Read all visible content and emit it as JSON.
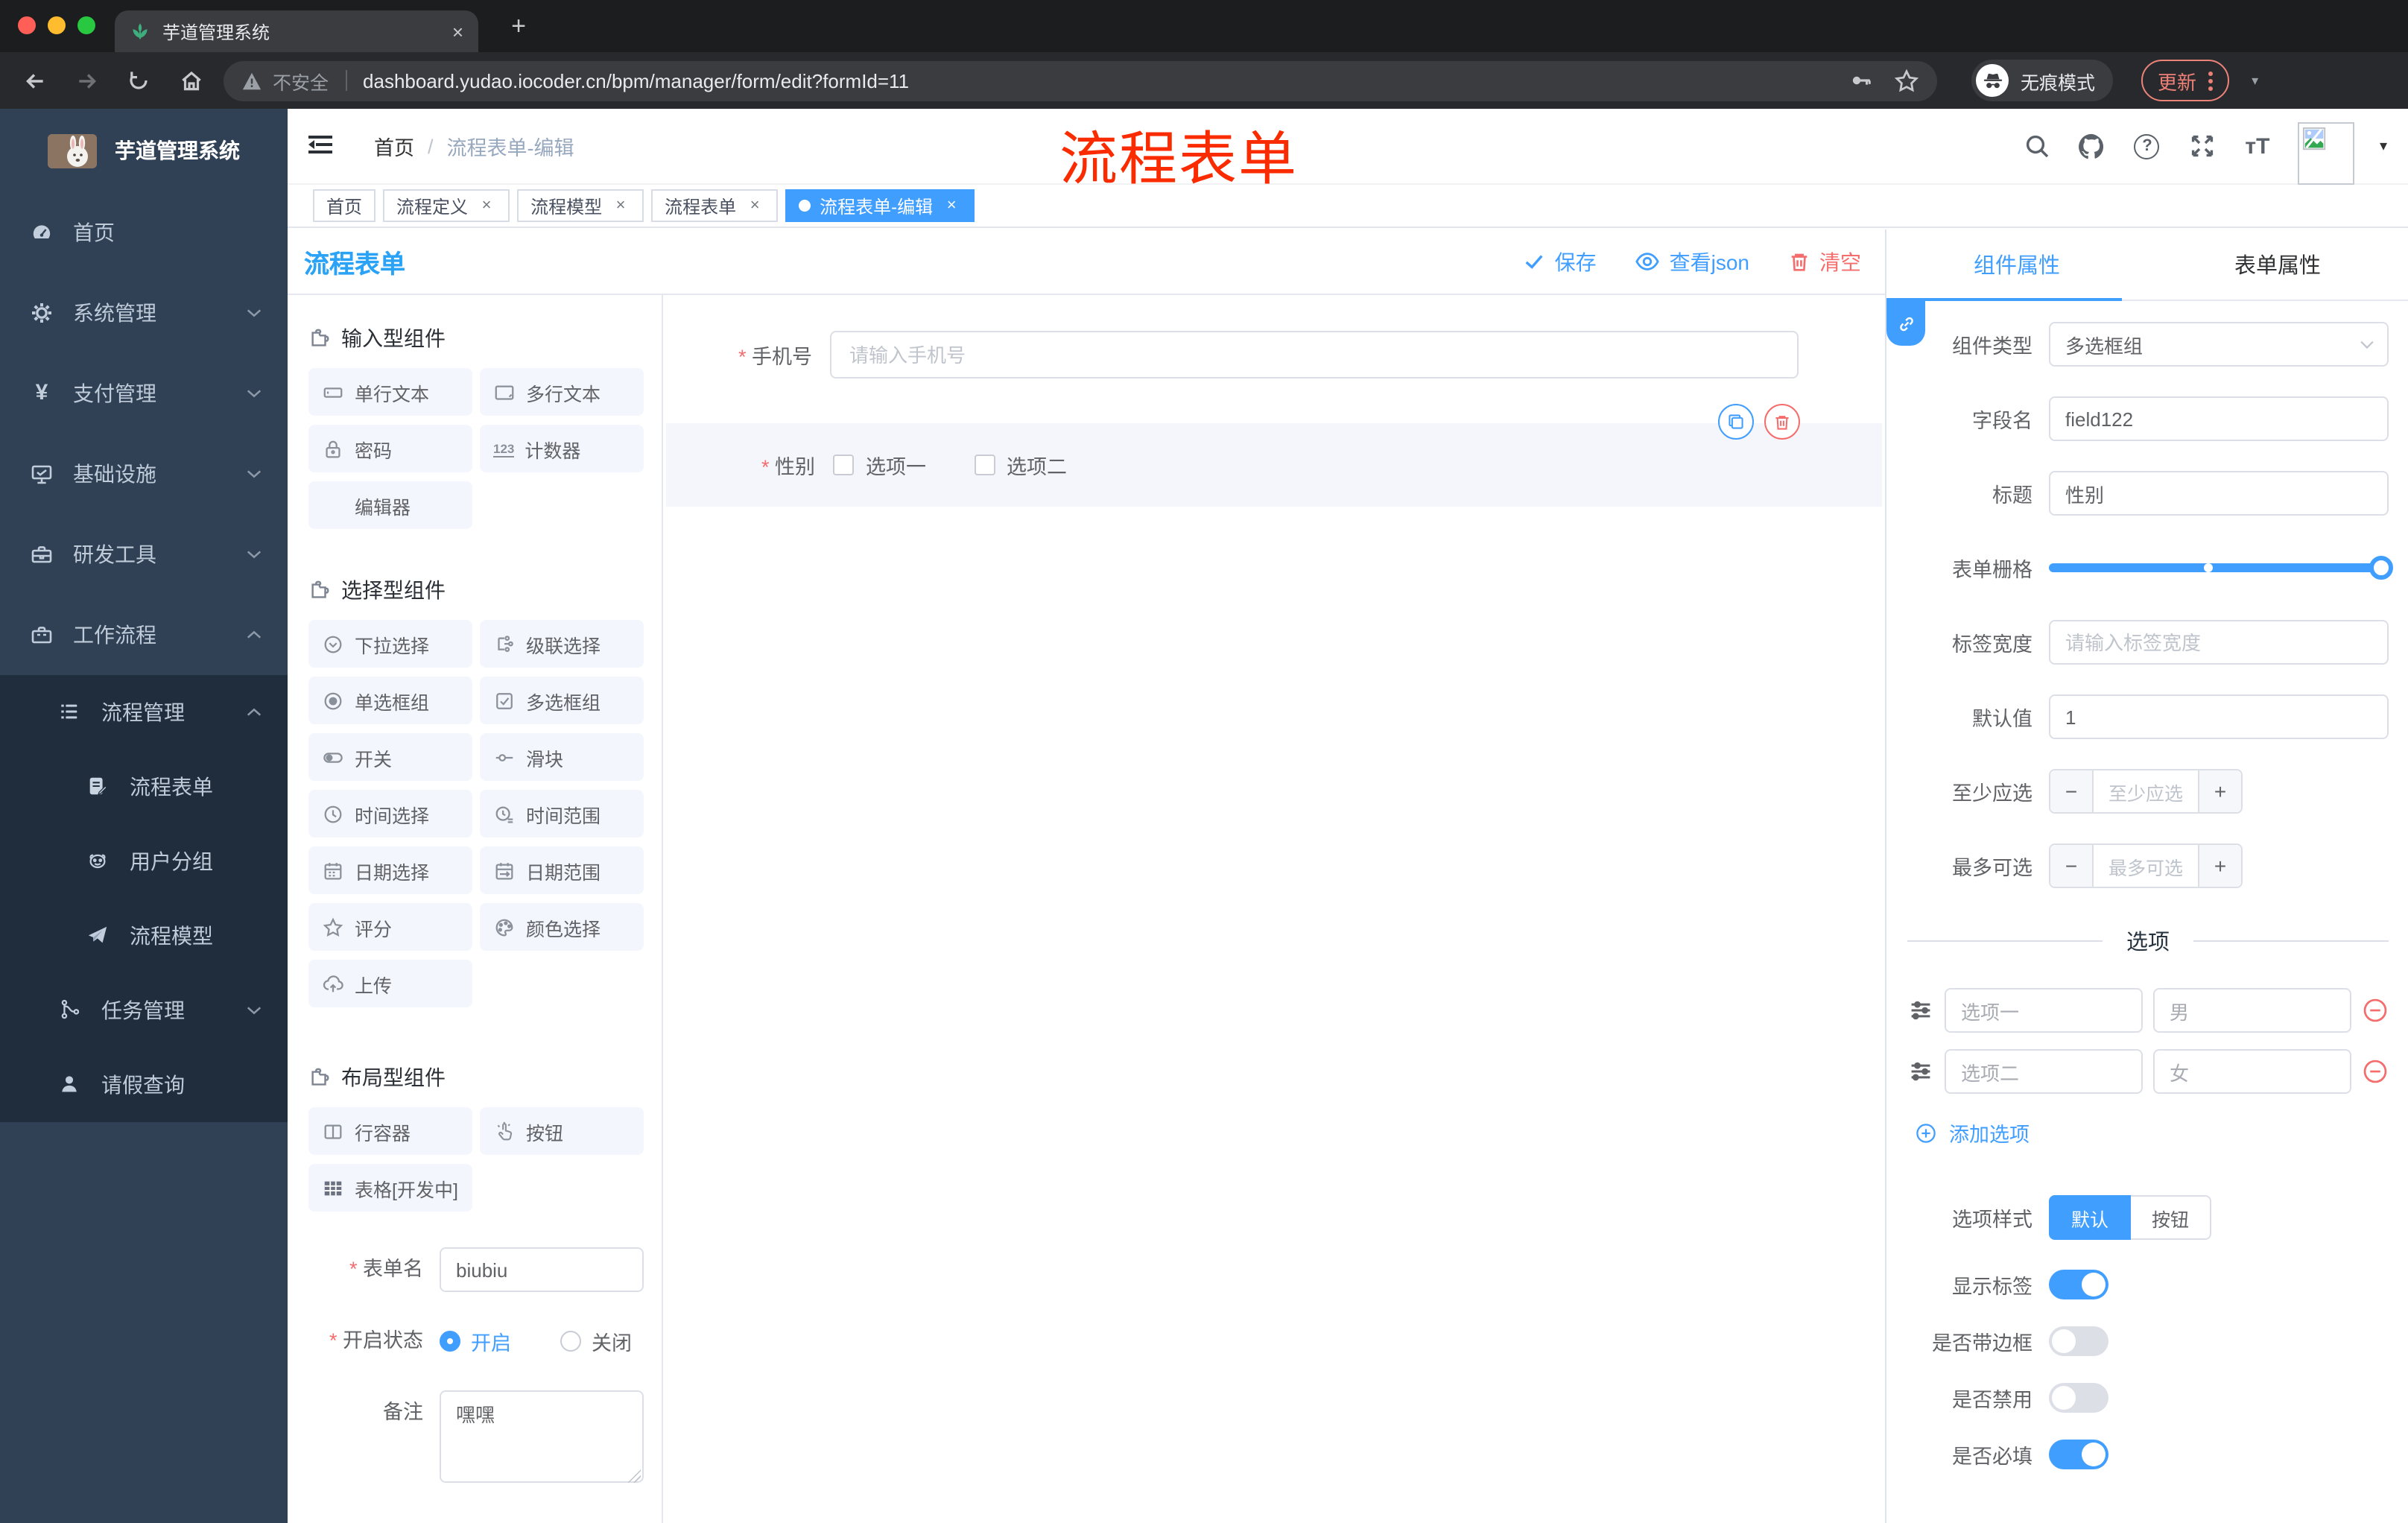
{
  "chrome": {
    "tab_title": "芋道管理系统",
    "new_tab_glyph": "+",
    "close_glyph": "×",
    "security_label": "不安全",
    "url": "dashboard.yudao.iocoder.cn/bpm/manager/form/edit?formId=11",
    "incognito_label": "无痕模式",
    "update_label": "更新",
    "caret_glyph": "▾",
    "colors": {
      "light_red": "#ff5f57",
      "light_yellow": "#febc2e",
      "light_green": "#28c840"
    }
  },
  "annotation": {
    "text": "流程表单",
    "color": "#fb2b00"
  },
  "sidebar": {
    "logo_title": "芋道管理系统",
    "items": [
      {
        "label": "首页",
        "arrow": ""
      },
      {
        "label": "系统管理",
        "arrow": "down"
      },
      {
        "label": "支付管理",
        "arrow": "down"
      },
      {
        "label": "基础设施",
        "arrow": "down"
      },
      {
        "label": "研发工具",
        "arrow": "down"
      },
      {
        "label": "工作流程",
        "arrow": "up"
      }
    ],
    "submenu": [
      {
        "label": "流程管理",
        "arrow": "up",
        "level": 1
      },
      {
        "label": "流程表单",
        "level": 2
      },
      {
        "label": "用户分组",
        "level": 2
      },
      {
        "label": "流程模型",
        "level": 2
      },
      {
        "label": "任务管理",
        "arrow": "down",
        "level": 1
      },
      {
        "label": "请假查询",
        "level": 1
      }
    ],
    "yen_glyph": "¥",
    "colors": {
      "bg": "#304156",
      "submenu_bg": "#1f2d3d",
      "text": "#bfcbd9"
    }
  },
  "navbar": {
    "breadcrumb_home": "首页",
    "breadcrumb_sep": "/",
    "breadcrumb_current": "流程表单-编辑",
    "help_glyph": "?",
    "font_size_glyph": "тT",
    "avatar_caret": "▾"
  },
  "tags": [
    {
      "label": "首页",
      "closable": false,
      "active": false
    },
    {
      "label": "流程定义",
      "closable": true,
      "active": false
    },
    {
      "label": "流程模型",
      "closable": true,
      "active": false
    },
    {
      "label": "流程表单",
      "closable": true,
      "active": false
    },
    {
      "label": "流程表单-编辑",
      "closable": true,
      "active": true
    }
  ],
  "designer": {
    "title": "流程表单",
    "save_label": "保存",
    "view_json_label": "查看json",
    "clear_label": "清空"
  },
  "palette": {
    "sections": [
      {
        "title": "输入型组件",
        "items": [
          "单行文本",
          "多行文本",
          "密码",
          "计数器",
          "编辑器"
        ]
      },
      {
        "title": "选择型组件",
        "items": [
          "下拉选择",
          "级联选择",
          "单选框组",
          "多选框组",
          "开关",
          "滑块",
          "时间选择",
          "时间范围",
          "日期选择",
          "日期范围",
          "评分",
          "颜色选择",
          "上传"
        ]
      },
      {
        "title": "布局型组件",
        "items": [
          "行容器",
          "按钮",
          "表格[开发中]"
        ]
      }
    ],
    "counter_icon_text": "123",
    "form": {
      "name_label": "表单名",
      "name_value": "biubiu",
      "status_label": "开启状态",
      "status_on": "开启",
      "status_off": "关闭",
      "remark_label": "备注",
      "remark_value": "嘿嘿"
    }
  },
  "canvas": {
    "phone": {
      "label": "手机号",
      "placeholder": "请输入手机号",
      "required": true
    },
    "gender": {
      "label": "性别",
      "required": true,
      "options": [
        "选项一",
        "选项二"
      ],
      "checked": [
        false,
        false
      ]
    }
  },
  "panel": {
    "tabs": [
      {
        "label": "组件属性",
        "active": true
      },
      {
        "label": "表单属性",
        "active": false
      }
    ],
    "fields": {
      "type_label": "组件类型",
      "type_value": "多选框组",
      "field_label": "字段名",
      "field_value": "field122",
      "title_label": "标题",
      "title_value": "性别",
      "grid_label": "表单栅格",
      "grid_slider": {
        "percent": 100,
        "mid_marker_percent": 47
      },
      "labelwidth_label": "标签宽度",
      "labelwidth_placeholder": "请输入标签宽度",
      "default_label": "默认值",
      "default_value": "1",
      "min_label": "至少应选",
      "min_placeholder": "至少应选",
      "max_label": "最多可选",
      "max_placeholder": "最多可选",
      "minus_glyph": "−",
      "plus_glyph": "+"
    },
    "options": {
      "divider_title": "选项",
      "rows": [
        {
          "label": "选项一",
          "value": "男"
        },
        {
          "label": "选项二",
          "value": "女"
        }
      ],
      "add_label": "添加选项"
    },
    "style": {
      "label": "选项样式",
      "seg_default": "默认",
      "seg_button": "按钮",
      "seg_active": "默认",
      "toggles": [
        {
          "label": "显示标签",
          "on": true
        },
        {
          "label": "是否带边框",
          "on": false
        },
        {
          "label": "是否禁用",
          "on": false
        },
        {
          "label": "是否必填",
          "on": true
        }
      ]
    },
    "accent": "#409eff",
    "danger": "#f56c6c"
  }
}
